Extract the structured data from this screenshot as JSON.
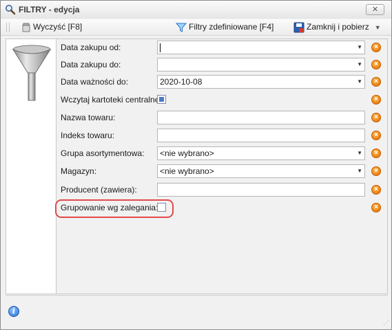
{
  "window": {
    "title": "FILTRY - edycja",
    "close_glyph": "✕"
  },
  "toolbar": {
    "clear_label": "Wyczyść [F8]",
    "filters_label": "Filtry zdefiniowane [F4]",
    "close_label": "Zamknij i pobierz",
    "dropdown_glyph": "▼"
  },
  "form": {
    "purchase_from": {
      "label": "Data zakupu od:",
      "value": ""
    },
    "purchase_to": {
      "label": "Data zakupu do:",
      "value": ""
    },
    "expiry_date": {
      "label": "Data ważności do:",
      "value": "2020-10-08"
    },
    "load_central": {
      "label": "Wczytaj kartoteki centralne:",
      "checked": true
    },
    "product_name": {
      "label": "Nazwa towaru:",
      "value": ""
    },
    "product_index": {
      "label": "Indeks towaru:",
      "value": ""
    },
    "product_group": {
      "label": "Grupa asortymentowa:",
      "value": "<nie wybrano>"
    },
    "warehouse": {
      "label": "Magazyn:",
      "value": "<nie wybrano>"
    },
    "producer": {
      "label": "Producent (zawiera):",
      "value": ""
    },
    "group_by_stock": {
      "label": "Grupowanie wg zalegania:",
      "checked": false
    }
  },
  "icons": {
    "clear_field": "clear-x-icon",
    "arrow": "▼",
    "info": "i",
    "accent_orange": "#e06b00",
    "highlight_red": "#e24a4a"
  }
}
